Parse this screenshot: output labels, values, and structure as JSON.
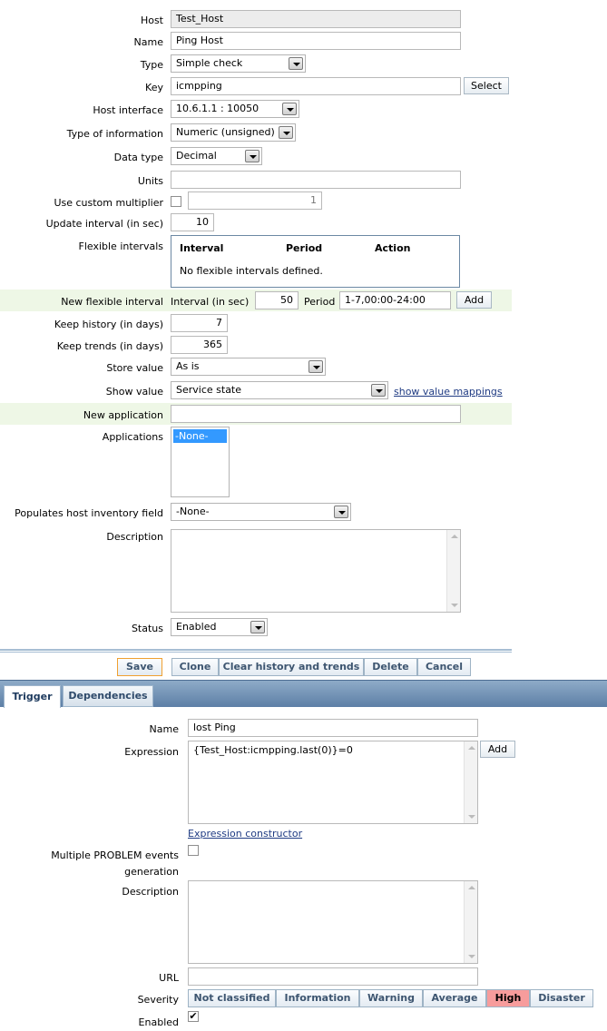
{
  "item": {
    "host_label": "Host",
    "host_value": "Test_Host",
    "name_label": "Name",
    "name_value": "Ping Host",
    "type_label": "Type",
    "type_value": "Simple check",
    "key_label": "Key",
    "key_value": "icmpping",
    "key_select": "Select",
    "iface_label": "Host interface",
    "iface_value": "10.6.1.1 : 10050",
    "toi_label": "Type of information",
    "toi_value": "Numeric (unsigned)",
    "dtype_label": "Data type",
    "dtype_value": "Decimal",
    "units_label": "Units",
    "units_value": "",
    "mult_label": "Use custom multiplier",
    "mult_value": "1",
    "upd_label": "Update interval (in sec)",
    "upd_value": "10",
    "flex_label": "Flexible intervals",
    "flex_cols": [
      "Interval",
      "Period",
      "Action"
    ],
    "flex_empty": "No flexible intervals defined.",
    "newflex_label": "New flexible interval",
    "newflex_int_label": "Interval (in sec)",
    "newflex_int_value": "50",
    "newflex_period_label": "Period",
    "newflex_period_value": "1-7,00:00-24:00",
    "newflex_add": "Add",
    "hist_label": "Keep history (in days)",
    "hist_value": "7",
    "trends_label": "Keep trends (in days)",
    "trends_value": "365",
    "store_label": "Store value",
    "store_value": "As is",
    "show_label": "Show value",
    "show_value": "Service state",
    "show_link": "show value mappings",
    "newapp_label": "New application",
    "newapp_value": "",
    "apps_label": "Applications",
    "apps_selected": "-None-",
    "inv_label": "Populates host inventory field",
    "inv_value": "-None-",
    "desc_label": "Description",
    "desc_value": "",
    "status_label": "Status",
    "status_value": "Enabled"
  },
  "buttons": {
    "save": "Save",
    "clone": "Clone",
    "clear": "Clear history and trends",
    "delete": "Delete",
    "cancel": "Cancel"
  },
  "tabs": {
    "trigger": "Trigger",
    "deps": "Dependencies"
  },
  "trigger": {
    "name_label": "Name",
    "name_value": "lost Ping",
    "expr_label": "Expression",
    "expr_value": "{Test_Host:icmpping.last(0)}=0",
    "expr_add": "Add",
    "expr_link": "Expression constructor",
    "multi_label_1": "Multiple PROBLEM events",
    "multi_label_2": "generation",
    "desc_label": "Description",
    "desc_value": "",
    "url_label": "URL",
    "url_value": "",
    "sev_label": "Severity",
    "severities": [
      "Not classified",
      "Information",
      "Warning",
      "Average",
      "High",
      "Disaster"
    ],
    "severity_selected": "High",
    "enabled_label": "Enabled"
  },
  "colors": {
    "accent_link": "#1f3b83",
    "highlight_row": "#eef7e6",
    "severity_high": "#f79c9c",
    "tab_bar": "#6b8fb8",
    "save_border": "#f0a030"
  }
}
